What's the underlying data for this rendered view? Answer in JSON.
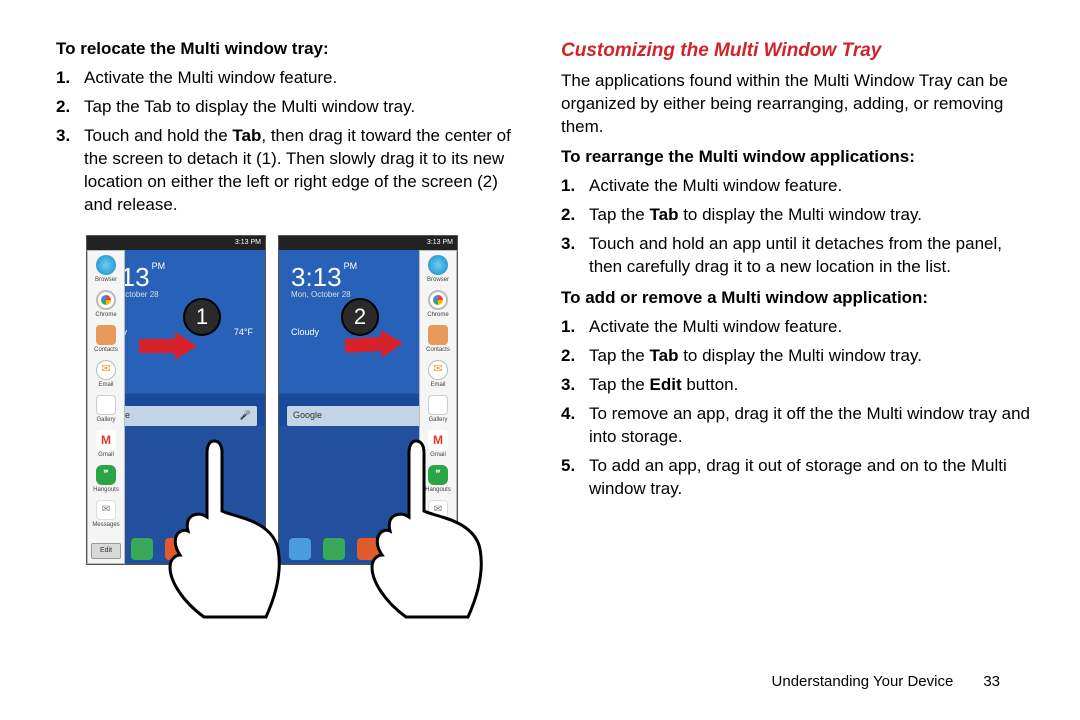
{
  "left": {
    "heading": "To relocate the Multi window tray:",
    "steps": [
      {
        "text": "Activate the Multi window feature."
      },
      {
        "text": "Tap the Tab to display the Multi window tray."
      },
      {
        "parts": [
          "Touch and hold the ",
          "Tab",
          ", then drag it toward the center of the screen to detach it (1). Then slowly drag it to its new location on either the left or right edge of the screen (2) and release."
        ]
      }
    ]
  },
  "figure": {
    "badge1": "1",
    "badge2": "2",
    "status_time": "3:13 PM",
    "clock": "3:13",
    "ampm": "PM",
    "date": "Mon, October 28",
    "weather_temp": "74°F",
    "weather_word": "Cloudy",
    "search": "Google",
    "edit": "Edit",
    "tray_apps": [
      "Browser",
      "Chrome",
      "Contacts",
      "Email",
      "Gallery",
      "Gmail",
      "Hangouts",
      "Messages"
    ]
  },
  "right": {
    "title": "Customizing the Multi Window Tray",
    "intro": "The applications found within the Multi Window Tray can be organized by either being rearranging, adding, or removing them.",
    "sub1": "To rearrange the Multi window applications:",
    "steps1": [
      {
        "text": "Activate the Multi window feature."
      },
      {
        "parts": [
          "Tap the ",
          "Tab",
          " to display the Multi window tray."
        ]
      },
      {
        "text": "Touch and hold an app until it detaches from the panel, then carefully drag it to a new location in the list."
      }
    ],
    "sub2": "To add or remove a Multi window application:",
    "steps2": [
      {
        "text": "Activate the Multi window feature."
      },
      {
        "parts": [
          "Tap the ",
          "Tab",
          " to display the Multi window tray."
        ]
      },
      {
        "parts": [
          "Tap the ",
          "Edit",
          " button."
        ]
      },
      {
        "text": "To remove an app, drag it off the the Multi window tray and into storage."
      },
      {
        "text": "To add an app, drag it out of storage and on to the Multi window tray."
      }
    ]
  },
  "footer": {
    "section": "Understanding Your Device",
    "page": "33"
  }
}
